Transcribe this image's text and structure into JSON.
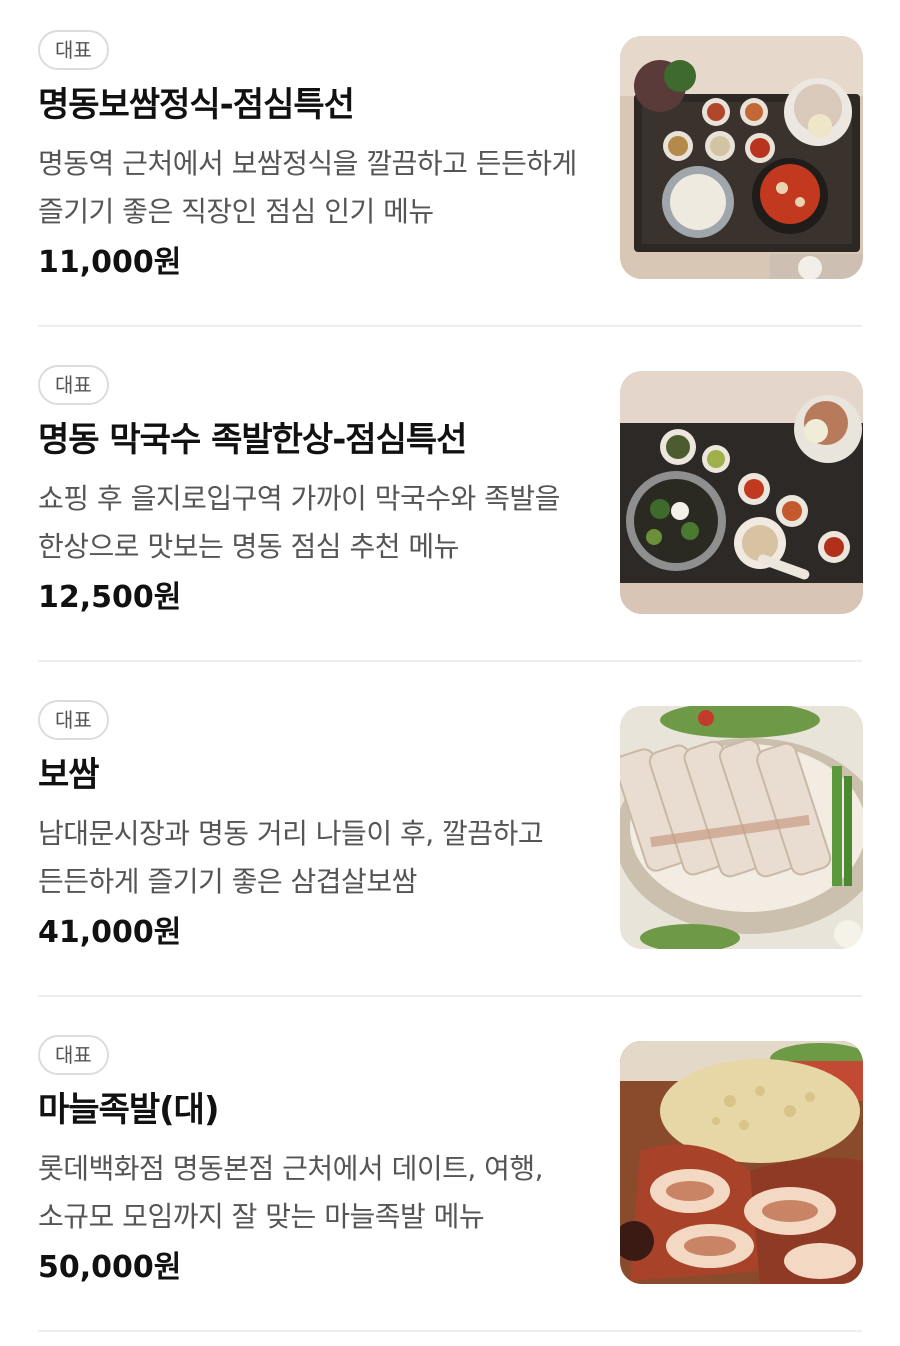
{
  "menu": {
    "items": [
      {
        "badge": "대표",
        "name": "명동보쌈정식-점심특선",
        "description": "명동역 근처에서 보쌈정식을 깔끔하고 든든하게 즐기기 좋은 직장인 점심 인기 메뉴",
        "price": "11,000원",
        "image": "bossam-set-meal-photo"
      },
      {
        "badge": "대표",
        "name": "명동 막국수 족발한상-점심특선",
        "description": "쇼핑 후 을지로입구역 가까이 막국수와 족발을 한상으로 맛보는 명동 점심 추천 메뉴",
        "price": "12,500원",
        "image": "makguksu-jokbal-set-photo"
      },
      {
        "badge": "대표",
        "name": "보쌈",
        "description": "남대문시장과 명동 거리 나들이 후, 깔끔하고 든든하게 즐기기 좋은 삼겹살보쌈",
        "price": "41,000원",
        "image": "bossam-pork-belly-photo"
      },
      {
        "badge": "대표",
        "name": "마늘족발(대)",
        "description": "롯데백화점 명동본점 근처에서 데이트, 여행, 소규모 모임까지 잘 맞는 마늘족발 메뉴",
        "price": "50,000원",
        "image": "garlic-jokbal-photo"
      }
    ]
  }
}
